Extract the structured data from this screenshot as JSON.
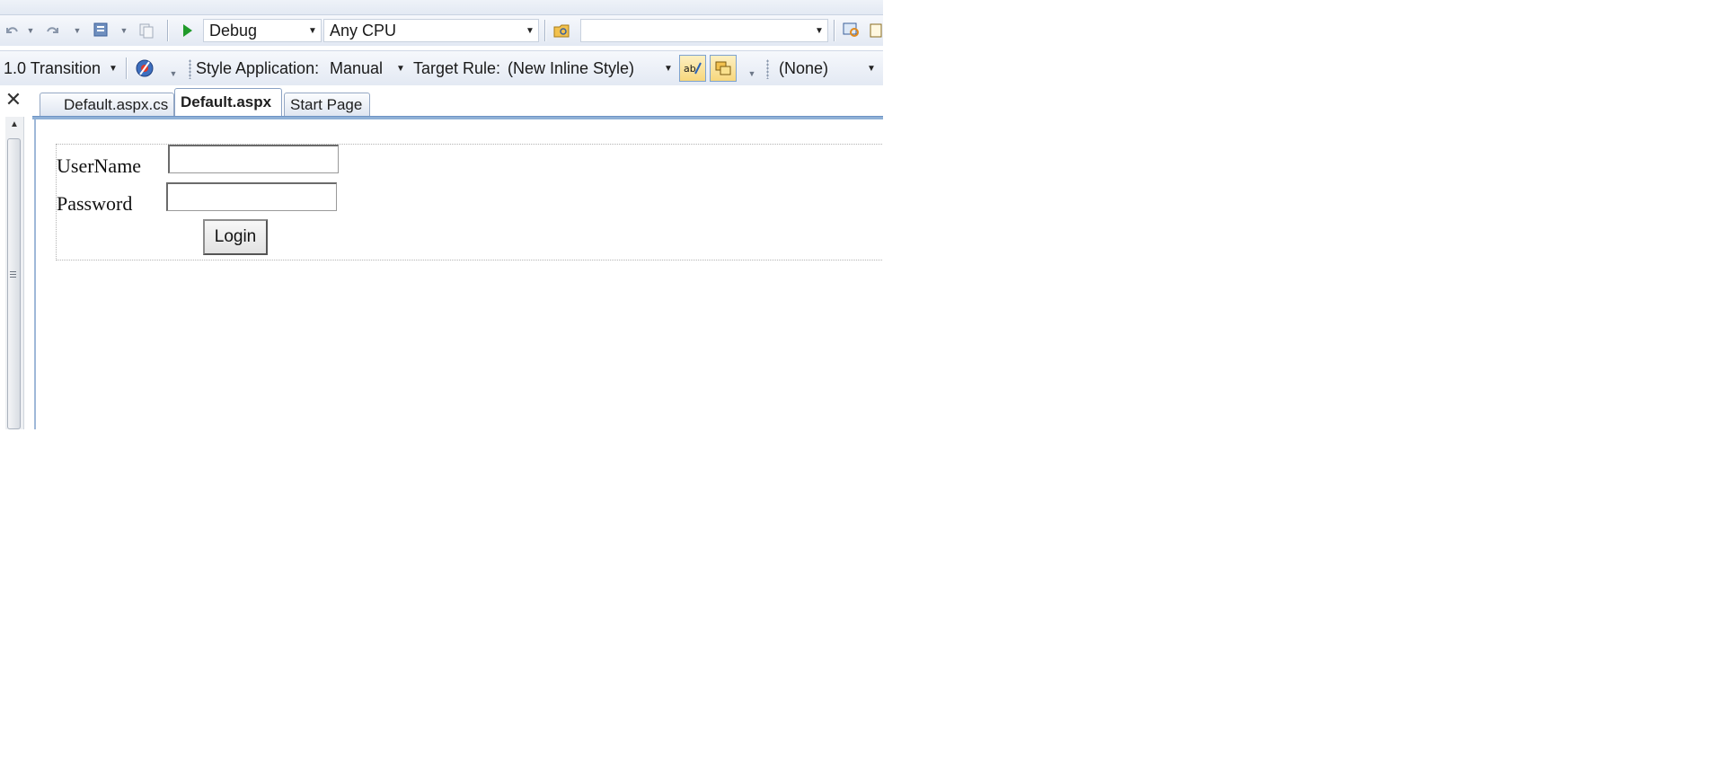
{
  "toolbar1": {
    "config_combo": "Debug",
    "platform_combo": "Any CPU",
    "find_combo": ""
  },
  "toolbar2": {
    "doctype_combo": "1.0 Transition",
    "style_application_label": "Style Application:",
    "style_application_value": "Manual",
    "target_rule_label": "Target Rule:",
    "target_rule_value": "(New Inline Style)",
    "class_combo": "(None)"
  },
  "tabs": [
    {
      "label": "Default.aspx.cs",
      "active": false
    },
    {
      "label": "Default.aspx",
      "active": true
    },
    {
      "label": "Start Page",
      "active": false
    }
  ],
  "form": {
    "username_label": "UserName",
    "username_value": "",
    "password_label": "Password",
    "password_value": "",
    "login_button": "Login"
  },
  "icons": {
    "close": "close-icon",
    "undo": "undo-icon",
    "redo": "redo-icon",
    "start": "start-debug-icon"
  },
  "colors": {
    "toolbar_bg": "#e3e9f3",
    "tab_underline": "#8fb0d6",
    "play_green": "#1f9a2a",
    "highlight_button": "#f7d77c"
  }
}
